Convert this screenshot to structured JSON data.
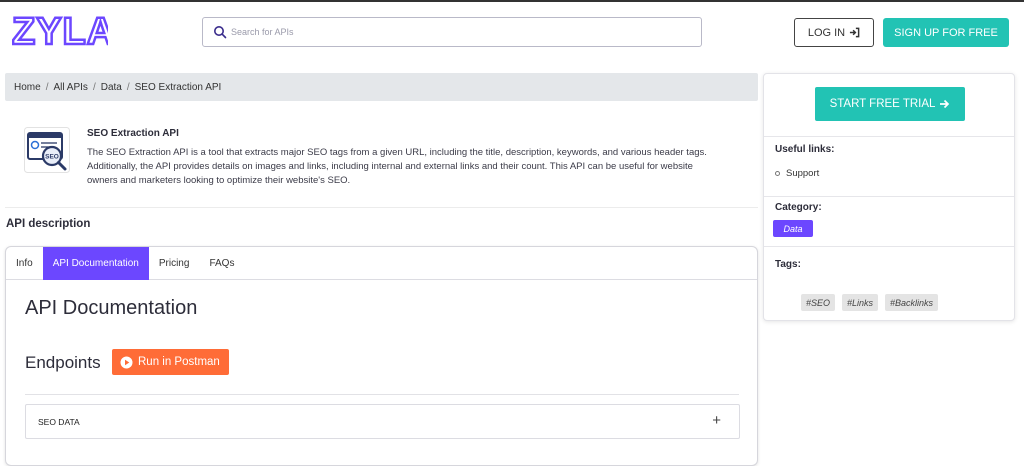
{
  "header": {
    "logo_text": "ZYLA",
    "search_placeholder": "Search for APIs",
    "login_label": "LOG IN",
    "signup_label": "SIGN UP FOR FREE"
  },
  "breadcrumb": [
    "Home",
    "All APIs",
    "Data",
    "SEO Extraction API"
  ],
  "api": {
    "name": "SEO Extraction API",
    "description": "The SEO Extraction API is a tool that extracts major SEO tags from a given URL, including the title, description, keywords, and various header tags. Additionally, the API provides details on images and links, including internal and external links and their count. This API can be useful for website owners and marketers looking to optimize their website's SEO.",
    "icon_label": "SEO"
  },
  "section_title": "API description",
  "tabs": [
    {
      "label": "Info",
      "active": false
    },
    {
      "label": "API Documentation",
      "active": true
    },
    {
      "label": "Pricing",
      "active": false
    },
    {
      "label": "FAQs",
      "active": false
    }
  ],
  "doc": {
    "title": "API Documentation",
    "endpoints_label": "Endpoints",
    "postman_label": "Run in Postman",
    "endpoint_name": "SEO DATA",
    "expand_symbol": "+"
  },
  "sidebar": {
    "trial_label": "START FREE TRIAL",
    "useful_links_label": "Useful links:",
    "support_label": "Support",
    "category_label": "Category:",
    "category_value": "Data",
    "tags_label": "Tags:",
    "tags": [
      "#SEO",
      "#Links",
      "#Backlinks"
    ]
  },
  "colors": {
    "brand_purple": "#6c47ff",
    "teal": "#22c3b4",
    "postman_orange": "#ff6c37"
  }
}
